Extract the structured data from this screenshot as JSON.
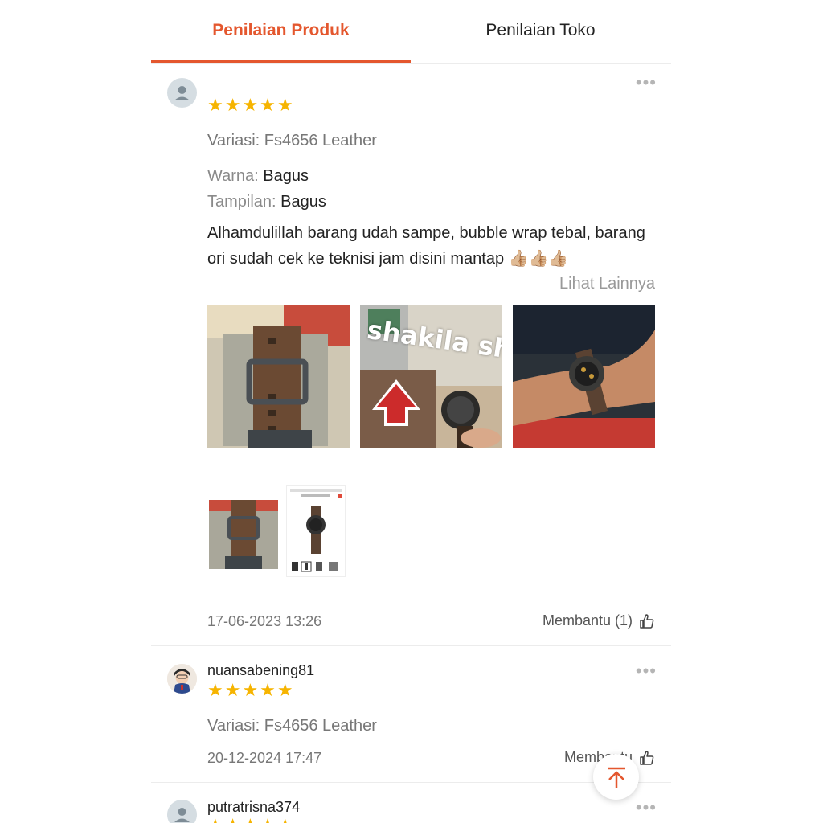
{
  "tabs": {
    "product": "Penilaian Produk",
    "shop": "Penilaian Toko"
  },
  "review1": {
    "stars": "★★★★★",
    "variation": "Variasi: Fs4656 Leather",
    "color_label": "Warna:",
    "color_value": "Bagus",
    "display_label": "Tampilan:",
    "display_value": "Bagus",
    "comment": "Alhamdulillah barang udah sampe, bubble wrap tebal, barang ori sudah cek ke teknisi jam disini mantap 👍🏼👍🏼👍🏼",
    "see_more": "Lihat Lainnya",
    "watermark": "shakila shope",
    "date": "17-06-2023 13:26",
    "helpful": "Membantu (1)"
  },
  "review2": {
    "username": "nuansabening81",
    "stars": "★★★★★",
    "variation": "Variasi: Fs4656 Leather",
    "date": "20-12-2024 17:47",
    "helpful": "Membantu"
  },
  "review3": {
    "username": "putratrisna374",
    "stars": "★★★★★"
  },
  "icons": {
    "more": "more-dots-icon",
    "like": "thumbs-up-icon",
    "scroll_top": "arrow-up-icon",
    "avatar": "user-icon"
  },
  "colors": {
    "accent": "#e4572e",
    "star": "#f6b400"
  }
}
